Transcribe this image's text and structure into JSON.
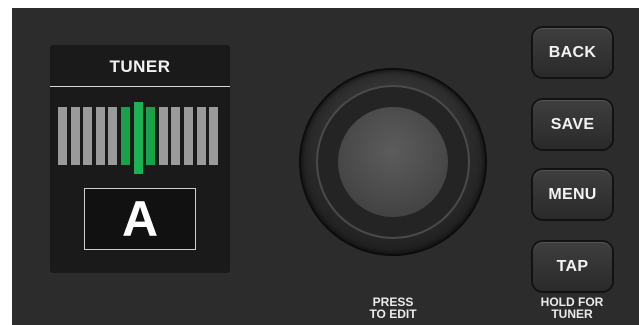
{
  "tuner": {
    "title": "TUNER",
    "note": "A",
    "meter_segments": [
      {
        "state": "gray"
      },
      {
        "state": "gray"
      },
      {
        "state": "gray"
      },
      {
        "state": "gray"
      },
      {
        "state": "gray"
      },
      {
        "state": "green"
      },
      {
        "state": "center"
      },
      {
        "state": "green"
      },
      {
        "state": "gray"
      },
      {
        "state": "gray"
      },
      {
        "state": "gray"
      },
      {
        "state": "gray"
      },
      {
        "state": "gray"
      }
    ]
  },
  "knob": {
    "caption_line1": "PRESS",
    "caption_line2": "TO EDIT"
  },
  "buttons": {
    "back": "BACK",
    "save": "SAVE",
    "menu": "MENU",
    "tap": "TAP"
  },
  "tap_caption": {
    "line1": "HOLD FOR",
    "line2": "TUNER"
  },
  "colors": {
    "panel": "#2c2c2c",
    "display": "#1a1a1a",
    "meter_gray": "#9a9a9a",
    "meter_green": "#18a24a"
  }
}
